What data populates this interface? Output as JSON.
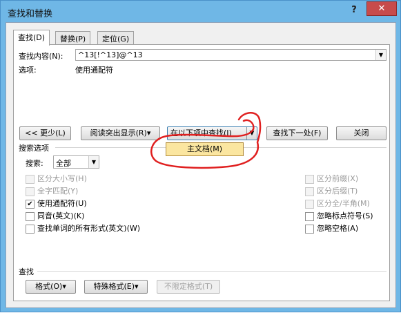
{
  "window": {
    "title": "查找和替换",
    "help": "?",
    "close": "✕"
  },
  "tabs": [
    {
      "label": "查找(D)"
    },
    {
      "label": "替换(P)"
    },
    {
      "label": "定位(G)"
    }
  ],
  "find": {
    "label": "查找内容(N):",
    "value": "^13[!^13]@^13",
    "options_label": "选项:",
    "options_value": "使用通配符"
  },
  "buttons": {
    "less": "<< 更少(L)",
    "reading_highlight": "阅读突出显示(R)▾",
    "find_in": "在以下项中查找(I)",
    "find_in_arrow": "▼",
    "find_next": "查找下一处(F)",
    "close": "关闭"
  },
  "dropdown": {
    "main_document": "主文档(M)"
  },
  "search_options": {
    "title": "搜索选项",
    "search_label": "搜索:",
    "search_value": "全部"
  },
  "left_options": [
    {
      "label": "区分大小写(H)",
      "checked": false,
      "disabled": true
    },
    {
      "label": "全字匹配(Y)",
      "checked": false,
      "disabled": true
    },
    {
      "label": "使用通配符(U)",
      "checked": true,
      "disabled": false
    },
    {
      "label": "同音(英文)(K)",
      "checked": false,
      "disabled": false
    },
    {
      "label": "查找单词的所有形式(英文)(W)",
      "checked": false,
      "disabled": false
    }
  ],
  "right_options": [
    {
      "label": "区分前缀(X)",
      "checked": false,
      "disabled": true
    },
    {
      "label": "区分后缀(T)",
      "checked": false,
      "disabled": true
    },
    {
      "label": "区分全/半角(M)",
      "checked": false,
      "disabled": true
    },
    {
      "label": "忽略标点符号(S)",
      "checked": false,
      "disabled": false
    },
    {
      "label": "忽略空格(A)",
      "checked": false,
      "disabled": false
    }
  ],
  "find_section": {
    "title": "查找",
    "format": "格式(O)▾",
    "special": "特殊格式(E)▾",
    "no_format": "不限定格式(T)"
  },
  "colors": {
    "title_bar": "#6fb7e6",
    "close": "#c74b4b",
    "annotation": "#e02020",
    "highlight": "#fbe6a0"
  }
}
